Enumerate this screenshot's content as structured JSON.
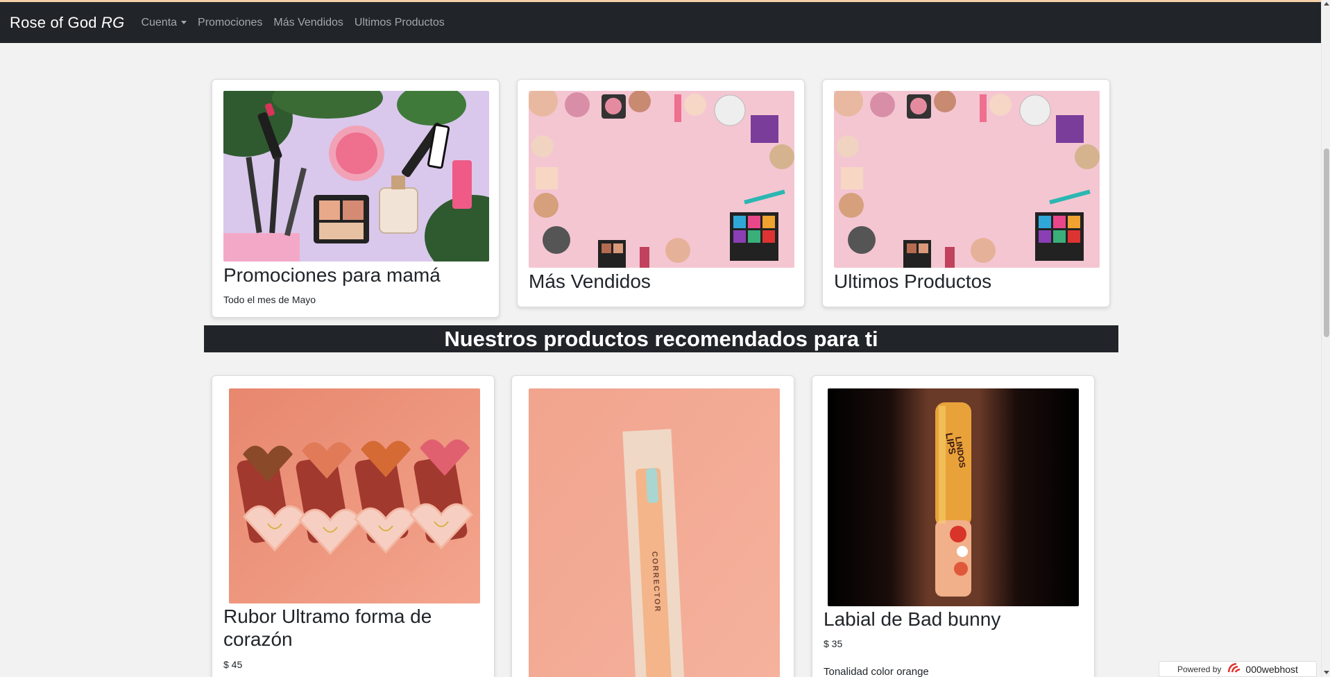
{
  "navbar": {
    "brand": "Rose of God ",
    "brand_italic": "RG",
    "links": {
      "cuenta": "Cuenta",
      "promociones": "Promociones",
      "mas_vendidos": "Más Vendidos",
      "ultimos": "Ultimos Productos"
    }
  },
  "categories": [
    {
      "title": "Promociones para mamá",
      "text": "Todo el mes de Mayo"
    },
    {
      "title": "Más Vendidos"
    },
    {
      "title": "Ultimos Productos"
    }
  ],
  "banner": "Nuestros productos recomendados para ti",
  "products": [
    {
      "title": "Rubor Ultramo forma de corazón",
      "price": "$ 45"
    },
    {
      "title": "",
      "price": ""
    },
    {
      "title": "Labial de Bad bunny",
      "price": "$ 35",
      "description": "Tonalidad color orange"
    }
  ],
  "product_image_text": {
    "corrector": "CORRECTOR",
    "lips": "LIPS",
    "lindos": "LINDOS"
  },
  "footer": {
    "powered_by": "Powered by",
    "host": "000webhost"
  },
  "icons": [
    "caret-down-icon",
    "webhost-logo-icon",
    "scroll-up-icon",
    "scroll-down-icon"
  ],
  "colors": {
    "navbar": "#212529",
    "background": "#f2f2f2",
    "accent_line": "#f4cfa8"
  }
}
